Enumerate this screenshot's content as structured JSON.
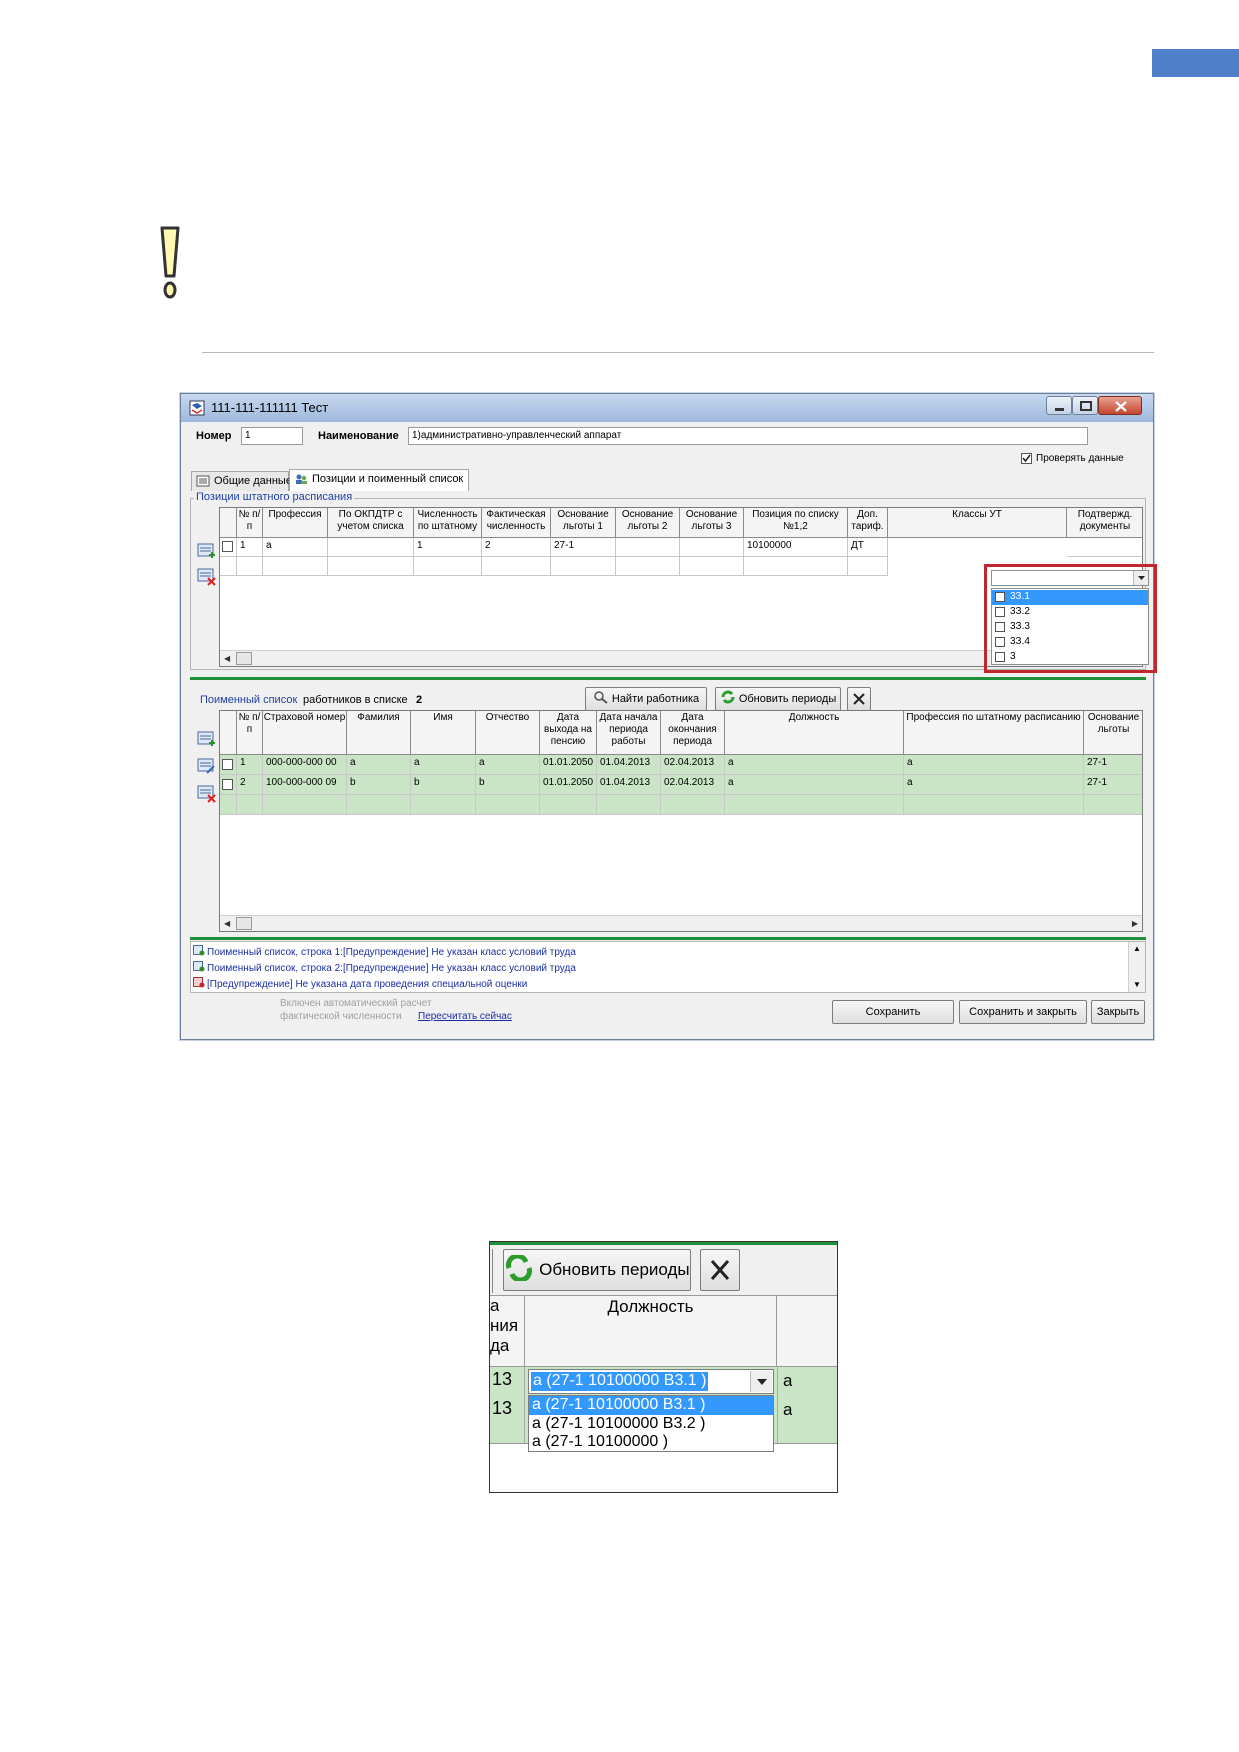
{
  "window": {
    "title": "111-111-111111 Тест",
    "number_label": "Номер",
    "number_value": "1",
    "name_label": "Наименование",
    "name_value": "1)административно-управленческий аппарат",
    "check_data_label": "Проверять данные",
    "check_data_checked": true,
    "tabs": [
      {
        "label": "Общие данные",
        "active": false
      },
      {
        "label": "Позиции и поименный список",
        "active": true
      }
    ]
  },
  "positions": {
    "group_title": "Позиции штатного расписания",
    "columns": [
      "№ п/п",
      "Профессия",
      "По ОКПДТР с учетом списка",
      "Численность по штатному",
      "Фактическая численность",
      "Основание льготы 1",
      "Основание льготы 2",
      "Основание льготы 3",
      "Позиция по списку №1,2",
      "Доп. тариф.",
      "Классы УТ",
      "Подтвержд. документы"
    ],
    "rows": [
      [
        "1",
        "а",
        "",
        "1",
        "2",
        "27-1",
        "",
        "",
        "10100000",
        "ДТ",
        "",
        ""
      ]
    ],
    "class_dropdown": {
      "options": [
        "3З.1",
        "3З.2",
        "3З.3",
        "3З.4",
        "3"
      ],
      "selected_index": 0
    }
  },
  "named_list": {
    "title": "Поименный список",
    "count_label": "работников в списке",
    "count": "2",
    "find_button": "Найти работника",
    "refresh_button": "Обновить периоды",
    "columns": [
      "№ п/п",
      "Страховой номер",
      "Фамилия",
      "Имя",
      "Отчество",
      "Дата выхода на пенсию",
      "Дата начала периода работы",
      "Дата окончания периода",
      "Должность",
      "Профессия по штатному расписанию",
      "Основание льготы"
    ],
    "rows": [
      [
        "1",
        "000-000-000 00",
        "a",
        "a",
        "a",
        "01.01.2050",
        "01.04.2013",
        "02.04.2013",
        "a",
        "a",
        "27-1"
      ],
      [
        "2",
        "100-000-000 09",
        "b",
        "b",
        "b",
        "01.01.2050",
        "01.04.2013",
        "02.04.2013",
        "a",
        "a",
        "27-1"
      ]
    ]
  },
  "warnings": [
    {
      "source": "Поименный список, строка 1:",
      "tag": "[Предупреждение]",
      "text": "Не указан класс условий труда"
    },
    {
      "source": "Поименный список, строка 2:",
      "tag": "[Предупреждение]",
      "text": "Не указан класс условий труда"
    },
    {
      "source": "",
      "tag": "[Предупреждение]",
      "text": "Не указана дата проведения специальной оценки"
    }
  ],
  "footer": {
    "auto_calc_line1": "Включен автоматический расчет",
    "auto_calc_line2": "фактической численности",
    "recalc_link": "Пересчитать сейчас",
    "save": "Сохранить",
    "save_close": "Сохранить и закрыть",
    "close": "Закрыть"
  },
  "zoom": {
    "refresh_button": "Обновить периоды",
    "left_header": [
      "а",
      "ния",
      "да"
    ],
    "position_header": "Должность",
    "row_left": [
      "13",
      "13"
    ],
    "row_right": [
      "а",
      "а"
    ],
    "combo_value": "а (27-1  10100000 В3.1 )",
    "options": [
      "а (27-1  10100000 В3.1 )",
      "а (27-1  10100000 В3.2 )",
      "а (27-1  10100000  )"
    ],
    "selected_index": 0
  },
  "colors": {
    "accent_blue": "#4f7fc9",
    "grid_green": "#c9e5c5",
    "highlight_red": "#c0282d",
    "selection_blue": "#3399ff",
    "link_blue": "#1c2fa0"
  }
}
